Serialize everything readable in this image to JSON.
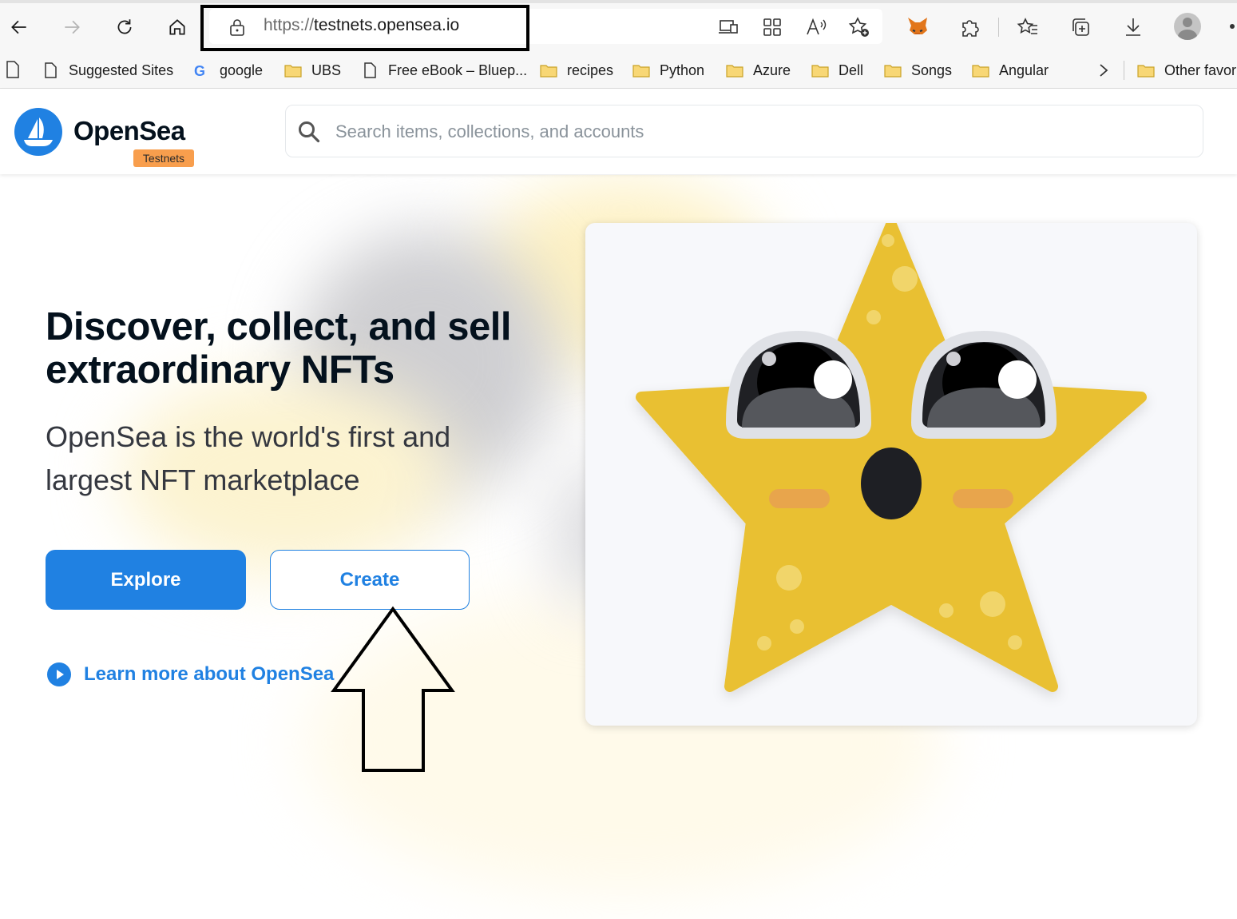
{
  "browser": {
    "url_protocol": "https://",
    "url_host": "testnets.opensea.io",
    "bookmarks": [
      {
        "label": "Suggested Sites",
        "icon": "page-icon"
      },
      {
        "label": "google",
        "icon": "google-icon"
      },
      {
        "label": "UBS",
        "icon": "folder-icon"
      },
      {
        "label": "Free eBook – Bluep...",
        "icon": "page-icon"
      },
      {
        "label": "recipes",
        "icon": "folder-icon"
      },
      {
        "label": "Python",
        "icon": "folder-icon"
      },
      {
        "label": "Azure",
        "icon": "folder-icon"
      },
      {
        "label": "Dell",
        "icon": "folder-icon"
      },
      {
        "label": "Songs",
        "icon": "folder-icon"
      },
      {
        "label": "Angular",
        "icon": "folder-icon"
      },
      {
        "label": "Other favor",
        "icon": "folder-icon"
      }
    ]
  },
  "site": {
    "logo_text": "OpenSea",
    "badge": "Testnets",
    "search_placeholder": "Search items, collections, and accounts"
  },
  "hero": {
    "title": "Discover, collect, and sell extraordinary NFTs",
    "subtitle": "OpenSea is the world's first and largest NFT marketplace",
    "explore_label": "Explore",
    "create_label": "Create",
    "learn_more_label": "Learn more about OpenSea"
  },
  "colors": {
    "brand_blue": "#2081e2",
    "badge_orange": "#f89e4d",
    "star_yellow": "#e9c032"
  }
}
